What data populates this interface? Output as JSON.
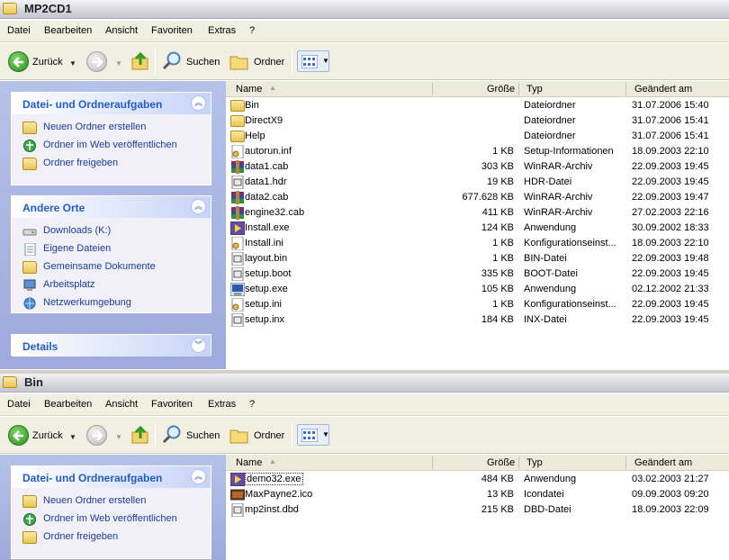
{
  "windows": [
    {
      "title": "MP2CD1",
      "menu": [
        "Datei",
        "Bearbeiten",
        "Ansicht",
        "Favoriten",
        "Extras",
        "?"
      ],
      "toolbar": {
        "back": "Zurück",
        "search": "Suchen",
        "folders": "Ordner"
      },
      "tasks": {
        "title": "Datei- und Ordneraufgaben",
        "items": [
          "Neuen Ordner erstellen",
          "Ordner im Web veröffentlichen",
          "Ordner freigeben"
        ]
      },
      "places": {
        "title": "Andere Orte",
        "items": [
          "Downloads (K:)",
          "Eigene Dateien",
          "Gemeinsame Dokumente",
          "Arbeitsplatz",
          "Netzwerkumgebung"
        ]
      },
      "details": {
        "title": "Details"
      },
      "columns": {
        "name": "Name",
        "size": "Größe",
        "type": "Typ",
        "modified": "Geändert am"
      },
      "files": [
        {
          "name": "Bin",
          "size": "",
          "type": "Dateiordner",
          "modified": "31.07.2006 15:40",
          "icon": "folder-icon"
        },
        {
          "name": "DirectX9",
          "size": "",
          "type": "Dateiordner",
          "modified": "31.07.2006 15:41",
          "icon": "folder-icon"
        },
        {
          "name": "Help",
          "size": "",
          "type": "Dateiordner",
          "modified": "31.07.2006 15:41",
          "icon": "folder-icon"
        },
        {
          "name": "autorun.inf",
          "size": "1 KB",
          "type": "Setup-Informationen",
          "modified": "18.09.2003 22:10",
          "icon": "settings-file-icon"
        },
        {
          "name": "data1.cab",
          "size": "303 KB",
          "type": "WinRAR-Archiv",
          "modified": "22.09.2003 19:45",
          "icon": "archive-icon"
        },
        {
          "name": "data1.hdr",
          "size": "19 KB",
          "type": "HDR-Datei",
          "modified": "22.09.2003 19:45",
          "icon": "file-icon"
        },
        {
          "name": "data2.cab",
          "size": "677.628 KB",
          "type": "WinRAR-Archiv",
          "modified": "22.09.2003 19:47",
          "icon": "archive-icon"
        },
        {
          "name": "engine32.cab",
          "size": "411 KB",
          "type": "WinRAR-Archiv",
          "modified": "27.02.2003 22:16",
          "icon": "archive-icon"
        },
        {
          "name": "Install.exe",
          "size": "124 KB",
          "type": "Anwendung",
          "modified": "30.09.2002 18:33",
          "icon": "app-icon"
        },
        {
          "name": "Install.ini",
          "size": "1 KB",
          "type": "Konfigurationseinst...",
          "modified": "18.09.2003 22:10",
          "icon": "settings-file-icon"
        },
        {
          "name": "layout.bin",
          "size": "1 KB",
          "type": "BIN-Datei",
          "modified": "22.09.2003 19:48",
          "icon": "file-icon"
        },
        {
          "name": "setup.boot",
          "size": "335 KB",
          "type": "BOOT-Datei",
          "modified": "22.09.2003 19:45",
          "icon": "file-icon"
        },
        {
          "name": "setup.exe",
          "size": "105 KB",
          "type": "Anwendung",
          "modified": "02.12.2002 21:33",
          "icon": "setup-app-icon"
        },
        {
          "name": "setup.ini",
          "size": "1 KB",
          "type": "Konfigurationseinst...",
          "modified": "22.09.2003 19:45",
          "icon": "settings-file-icon"
        },
        {
          "name": "setup.inx",
          "size": "184 KB",
          "type": "INX-Datei",
          "modified": "22.09.2003 19:45",
          "icon": "file-icon"
        }
      ]
    },
    {
      "title": "Bin",
      "menu": [
        "Datei",
        "Bearbeiten",
        "Ansicht",
        "Favoriten",
        "Extras",
        "?"
      ],
      "toolbar": {
        "back": "Zurück",
        "search": "Suchen",
        "folders": "Ordner"
      },
      "tasks": {
        "title": "Datei- und Ordneraufgaben",
        "items": [
          "Neuen Ordner erstellen",
          "Ordner im Web veröffentlichen",
          "Ordner freigeben"
        ]
      },
      "columns": {
        "name": "Name",
        "size": "Größe",
        "type": "Typ",
        "modified": "Geändert am"
      },
      "files": [
        {
          "name": "demo32.exe",
          "size": "484 KB",
          "type": "Anwendung",
          "modified": "03.02.2003 21:27",
          "icon": "app-icon"
        },
        {
          "name": "MaxPayne2.ico",
          "size": "13 KB",
          "type": "Icondatei",
          "modified": "09.09.2003 09:20",
          "icon": "image-icon"
        },
        {
          "name": "mp2inst.dbd",
          "size": "215 KB",
          "type": "DBD-Datei",
          "modified": "18.09.2003 22:09",
          "icon": "file-icon"
        }
      ]
    }
  ]
}
